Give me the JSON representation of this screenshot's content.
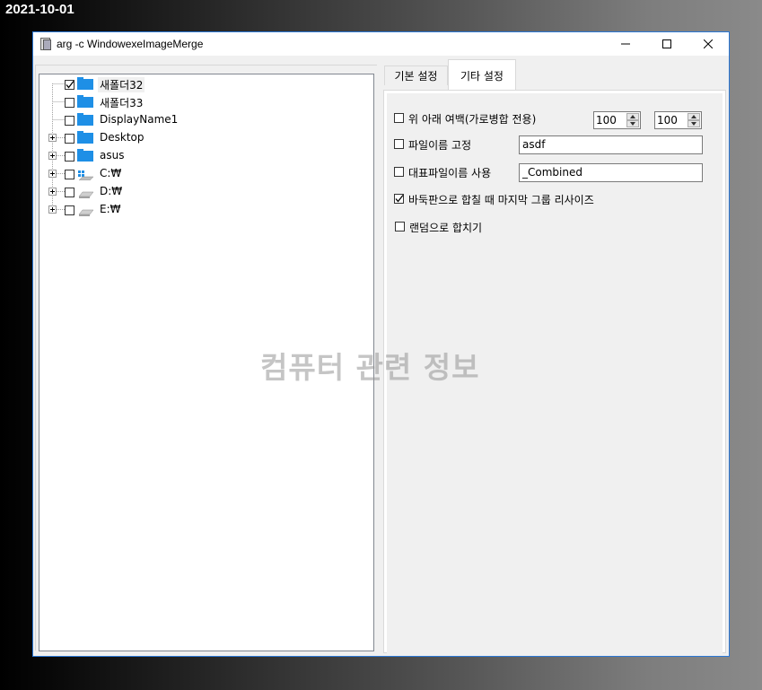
{
  "date_stamp": "2021-10-01",
  "window": {
    "title": "arg -c  WindowexeImageMerge",
    "accent_color": "#2b78d6"
  },
  "tree": {
    "items": [
      {
        "label": "새폴더32",
        "checked": true,
        "icon": "folder-icon",
        "expandable": false
      },
      {
        "label": "새폴더33",
        "checked": false,
        "icon": "folder-icon",
        "expandable": false
      },
      {
        "label": "DisplayName1",
        "checked": false,
        "icon": "folder-icon",
        "expandable": false
      },
      {
        "label": "Desktop",
        "checked": false,
        "icon": "folder-icon",
        "expandable": true
      },
      {
        "label": "asus",
        "checked": false,
        "icon": "folder-icon",
        "expandable": true
      },
      {
        "label": "C:₩",
        "checked": false,
        "icon": "windows-drive-icon",
        "expandable": true
      },
      {
        "label": "D:₩",
        "checked": false,
        "icon": "drive-icon",
        "expandable": true
      },
      {
        "label": "E:₩",
        "checked": false,
        "icon": "drive-icon",
        "expandable": true
      }
    ]
  },
  "tabs": [
    {
      "label": "기본 설정",
      "active": false
    },
    {
      "label": "기타 설정",
      "active": true
    }
  ],
  "options": {
    "margin": {
      "label": "위 아래 여백(가로병합 전용)",
      "checked": false,
      "value1": "100",
      "value2": "100"
    },
    "fixed_name": {
      "label": "파일이름 고정",
      "checked": false,
      "value": "asdf"
    },
    "rep_name": {
      "label": "대표파일이름 사용",
      "checked": false,
      "value": "_Combined"
    },
    "resize_last": {
      "label": "바둑판으로 합칠 때 마지막 그룹 리사이즈",
      "checked": true
    },
    "random": {
      "label": "랜덤으로 합치기",
      "checked": false
    }
  },
  "watermark": "컴퓨터 관련 정보"
}
